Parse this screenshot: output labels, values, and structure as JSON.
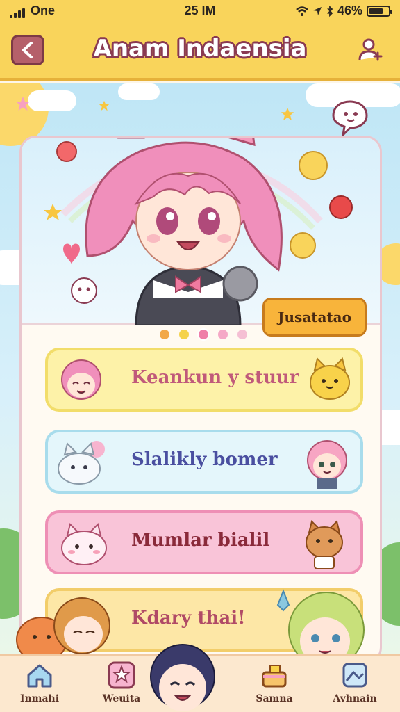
{
  "status_bar": {
    "carrier": "One",
    "time": "25 IM",
    "battery": "46%"
  },
  "header": {
    "title": "Anam Indaensia",
    "back_icon": "chevron-left-icon",
    "profile_icon": "user-add-icon"
  },
  "hero": {
    "badge": "Jusatatao",
    "carousel_pages": 5,
    "carousel_active": 3
  },
  "menu": [
    {
      "label": "Keankun y stuur",
      "color": "#c05a7a"
    },
    {
      "label": "Slalikly bomer",
      "color": "#4a4fa0"
    },
    {
      "label": "Mumlar bialil",
      "color": "#8a2a3a"
    },
    {
      "label": "Kdary thai!",
      "color": "#b04a66"
    }
  ],
  "nav": [
    {
      "label": "Inmahi",
      "icon": "home-icon"
    },
    {
      "label": "Weuita",
      "icon": "star-icon"
    },
    {
      "label": "Samna",
      "icon": "cake-icon"
    },
    {
      "label": "Avhnain",
      "icon": "map-icon"
    }
  ],
  "colors": {
    "header": "#f9d45b",
    "accent": "#b5606a",
    "sky": "#bfe6f6"
  }
}
